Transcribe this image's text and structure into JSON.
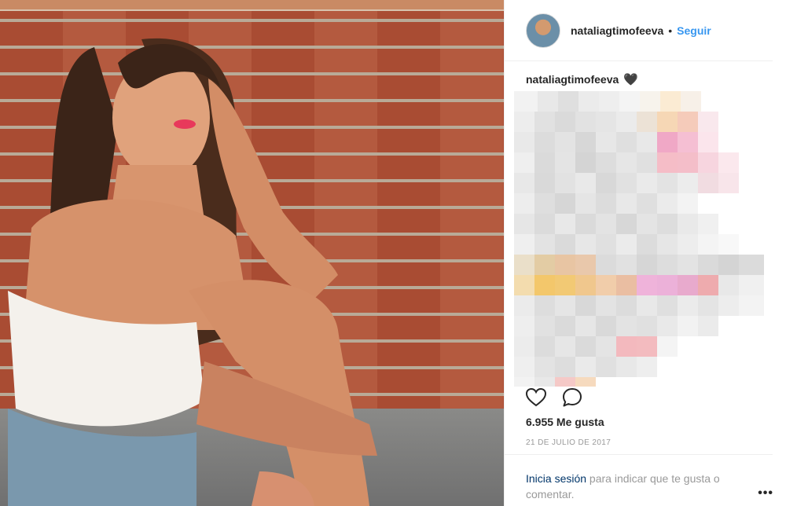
{
  "post": {
    "author": "nataliagtimofeeva",
    "follow_label": "Seguir",
    "separator": "•",
    "caption_user": "nataliagtimofeeva",
    "caption_emoji": "🖤",
    "likes": "6.955 Me gusta",
    "date": "21 DE JULIO DE 2017",
    "login_link": "Inicia sesión",
    "login_text": " para indicar que te gusta o comentar.",
    "more": "•••"
  },
  "icons": {
    "like": "heart-outline-icon",
    "comment": "comment-bubble-icon",
    "more": "more-options-icon"
  },
  "colors": {
    "link": "#3897f0",
    "login_link": "#003569",
    "muted": "#999999",
    "text": "#262626"
  }
}
